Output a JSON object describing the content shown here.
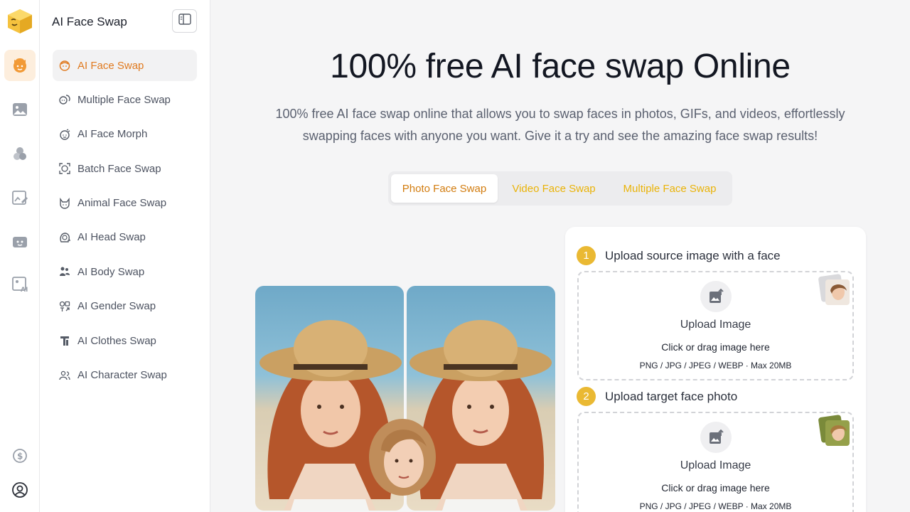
{
  "app": {
    "title": "AI Face Swap",
    "accent": "#e07a1f",
    "brand_yellow": "#eab933"
  },
  "rail": {
    "items": [
      {
        "icon": "face-swap-icon",
        "active": true
      },
      {
        "icon": "image-icon"
      },
      {
        "icon": "circles-icon"
      },
      {
        "icon": "edit-image-icon"
      },
      {
        "icon": "video-face-icon"
      },
      {
        "icon": "ai-image-icon"
      }
    ],
    "bottom": [
      {
        "icon": "credits-icon"
      },
      {
        "icon": "user-account-icon"
      }
    ]
  },
  "sidebar": {
    "title": "AI Face Swap",
    "items": [
      {
        "label": "AI Face Swap",
        "icon": "face-icon",
        "active": true
      },
      {
        "label": "Multiple Face Swap",
        "icon": "multiple-face-icon"
      },
      {
        "label": "AI Face Morph",
        "icon": "face-morph-icon"
      },
      {
        "label": "Batch Face Swap",
        "icon": "batch-face-icon"
      },
      {
        "label": "Animal Face Swap",
        "icon": "animal-face-icon"
      },
      {
        "label": "AI Head Swap",
        "icon": "head-icon"
      },
      {
        "label": "AI Body Swap",
        "icon": "body-icon"
      },
      {
        "label": "AI Gender Swap",
        "icon": "gender-icon"
      },
      {
        "label": "AI Clothes Swap",
        "icon": "clothes-icon"
      },
      {
        "label": "AI Character Swap",
        "icon": "character-icon"
      }
    ]
  },
  "hero": {
    "title": "100% free AI face swap Online",
    "description": "100% free AI face swap online that allows you to swap faces in photos, GIFs, and videos, effortlessly swapping faces with anyone you want. Give it a try and see the amazing face swap results!"
  },
  "tabs": [
    {
      "label": "Photo Face Swap",
      "active": true
    },
    {
      "label": "Video Face Swap"
    },
    {
      "label": "Multiple Face Swap"
    }
  ],
  "upload": {
    "step1": {
      "number": "1",
      "label": "Upload source image with a face"
    },
    "step2": {
      "number": "2",
      "label": "Upload target face photo"
    },
    "box_title": "Upload Image",
    "box_hint": "Click or drag image here",
    "box_formats": "PNG / JPG / JPEG / WEBP · Max 20MB"
  }
}
